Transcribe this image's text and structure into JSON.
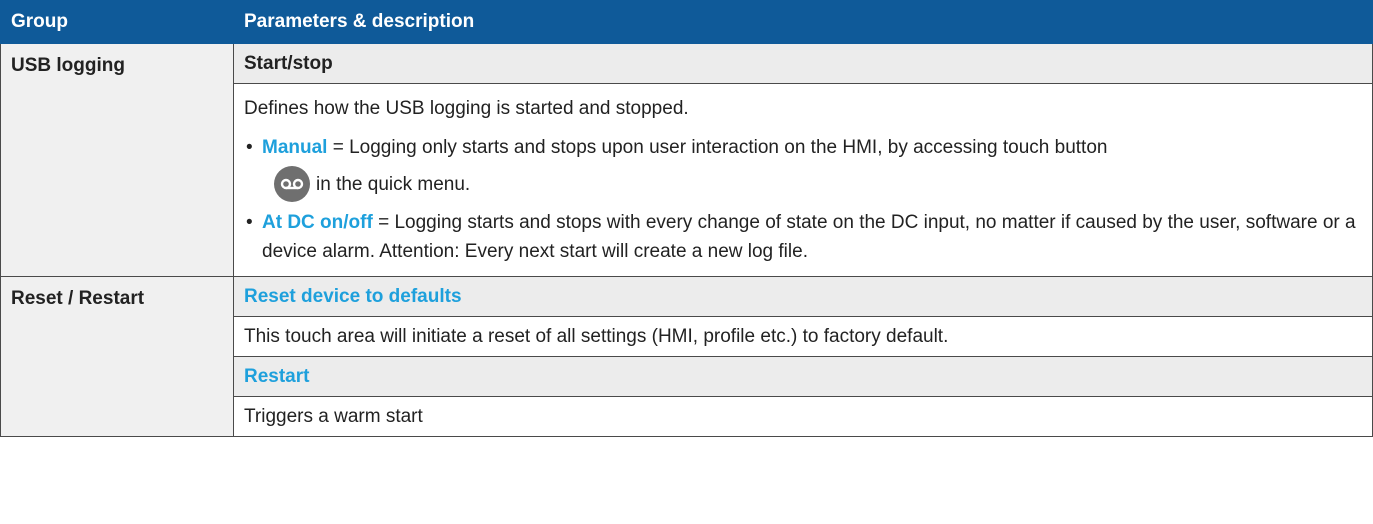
{
  "header": {
    "group": "Group",
    "params": "Parameters & description"
  },
  "usb": {
    "group": "USB logging",
    "param": "Start/stop",
    "intro": "Defines how the USB logging is started and stopped.",
    "bullet1_key": "Manual",
    "bullet1_text": " = Logging only starts and stops upon user interaction on the HMI, by accessing touch button",
    "bullet1_after": "in the quick menu.",
    "bullet2_key": "At DC on/off",
    "bullet2_text": " = Logging starts and stops with every change of state on the DC input, no matter if caused by the user, software or a device alarm. Attention: Every next start will create a new log file."
  },
  "reset": {
    "group": "Reset / Restart",
    "param1": "Reset device to defaults",
    "desc1": "This touch area will initiate a reset of all settings (HMI, profile etc.) to factory default.",
    "param2": "Restart",
    "desc2": "Triggers a warm start"
  },
  "icons": {
    "logging_button": "recording-icon"
  },
  "colors": {
    "header_bg": "#0f5a99",
    "keyword": "#1ea0dc",
    "row_bg": "#ececec"
  }
}
